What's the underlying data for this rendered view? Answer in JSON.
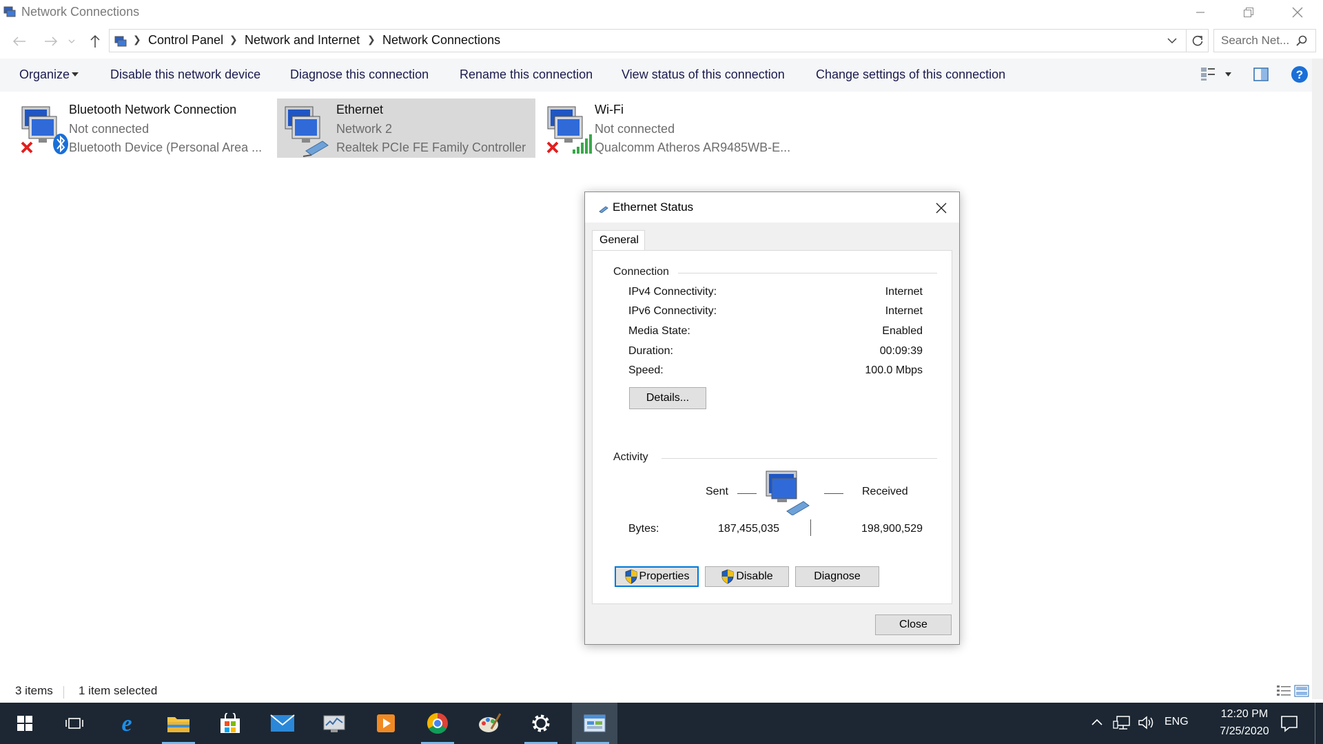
{
  "window": {
    "title": "Network Connections"
  },
  "address": {
    "crumbs": [
      "Control Panel",
      "Network and Internet",
      "Network Connections"
    ],
    "search_placeholder": "Search Net..."
  },
  "toolbar": {
    "organize": "Organize",
    "disable_device": "Disable this network device",
    "diagnose": "Diagnose this connection",
    "rename": "Rename this connection",
    "view_status": "View status of this connection",
    "change_settings": "Change settings of this connection"
  },
  "connections": [
    {
      "name": "Bluetooth Network Connection",
      "status": "Not connected",
      "device": "Bluetooth Device (Personal Area ..."
    },
    {
      "name": "Ethernet",
      "status": "Network 2",
      "device": "Realtek PCIe FE Family Controller"
    },
    {
      "name": "Wi-Fi",
      "status": "Not connected",
      "device": "Qualcomm Atheros AR9485WB-E..."
    }
  ],
  "dialog": {
    "title": "Ethernet Status",
    "tab": "General",
    "connection_group": "Connection",
    "rows": [
      {
        "label": "IPv4 Connectivity:",
        "value": "Internet"
      },
      {
        "label": "IPv6 Connectivity:",
        "value": "Internet"
      },
      {
        "label": "Media State:",
        "value": "Enabled"
      },
      {
        "label": "Duration:",
        "value": "00:09:39"
      },
      {
        "label": "Speed:",
        "value": "100.0 Mbps"
      }
    ],
    "details_button": "Details...",
    "activity_group": "Activity",
    "sent_label": "Sent",
    "received_label": "Received",
    "bytes_label": "Bytes:",
    "bytes_sent": "187,455,035",
    "bytes_received": "198,900,529",
    "properties_button": "Properties",
    "disable_button": "Disable",
    "diagnose_button": "Diagnose",
    "close_button": "Close"
  },
  "status": {
    "items": "3 items",
    "selected": "1 item selected"
  },
  "taskbar": {
    "apps": [
      "start-icon",
      "task-view-icon",
      "edge-icon",
      "file-explorer-icon",
      "store-icon",
      "mail-icon",
      "network-monitor-icon",
      "media-player-icon",
      "chrome-icon",
      "paint-icon",
      "settings-icon",
      "control-panel-icon"
    ],
    "language": "ENG",
    "time": "12:20 PM",
    "date": "7/25/2020"
  },
  "colors": {
    "selection": "#d9d9d9",
    "accent": "#0078d7",
    "taskbar": "#1c2733",
    "link": "#1b1b4f"
  }
}
